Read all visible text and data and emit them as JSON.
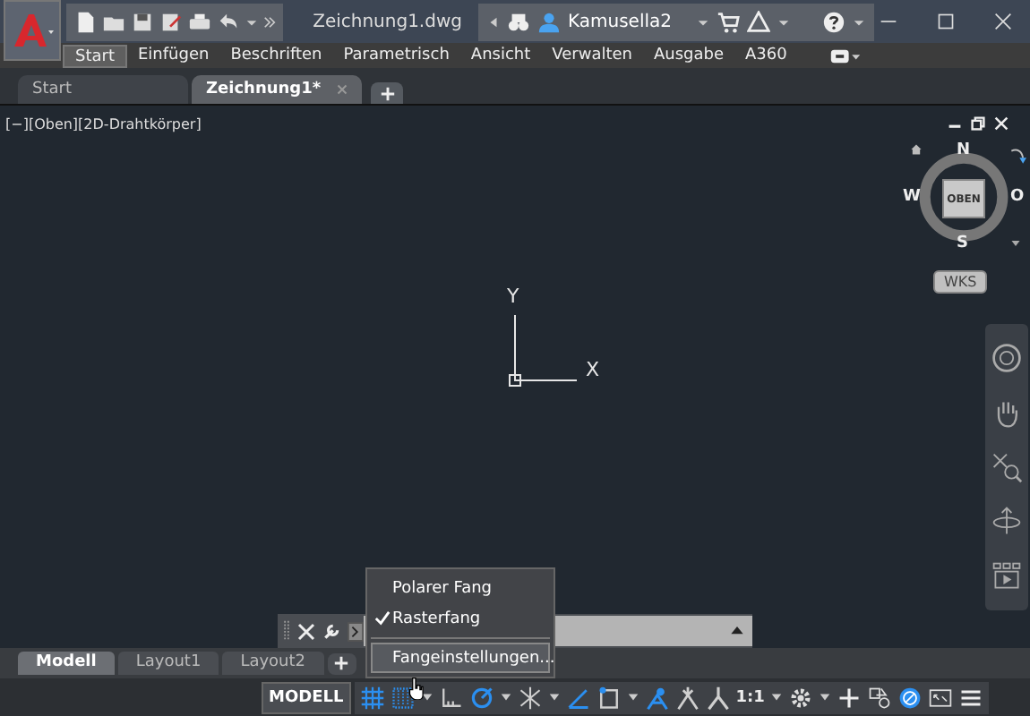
{
  "window": {
    "title": "Zeichnung1.dwg",
    "user": "Kamusella2"
  },
  "ribbon_tabs": [
    {
      "label": "Start",
      "selected": true
    },
    {
      "label": "Einfügen",
      "selected": false
    },
    {
      "label": "Beschriften",
      "selected": false
    },
    {
      "label": "Parametrisch",
      "selected": false
    },
    {
      "label": "Ansicht",
      "selected": false
    },
    {
      "label": "Verwalten",
      "selected": false
    },
    {
      "label": "Ausgabe",
      "selected": false
    },
    {
      "label": "A360",
      "selected": false
    }
  ],
  "file_tabs": [
    {
      "label": "Start",
      "selected": false
    },
    {
      "label": "Zeichnung1*",
      "selected": true
    }
  ],
  "viewport": {
    "label": "[−][Oben][2D-Drahtkörper]",
    "ucs": {
      "x": "X",
      "y": "Y"
    }
  },
  "viewcube": {
    "face": "OBEN",
    "north": "N",
    "south": "S",
    "west": "W",
    "east": "O",
    "ucs_menu": "WKS"
  },
  "popup_menu": [
    {
      "label": "Polarer Fang",
      "checked": false,
      "highlighted": false
    },
    {
      "label": "Rasterfang",
      "checked": true,
      "highlighted": false
    },
    {
      "label": "Fangeinstellungen...",
      "checked": false,
      "highlighted": true
    }
  ],
  "layout_tabs": [
    {
      "label": "Modell",
      "selected": true
    },
    {
      "label": "Layout1",
      "selected": false
    },
    {
      "label": "Layout2",
      "selected": false
    }
  ],
  "status_bar": {
    "model": "MODELL",
    "scale": "1:1",
    "tools": [
      {
        "kind": "grid",
        "on": true
      },
      {
        "kind": "snap",
        "on": true
      },
      {
        "kind": "ortho",
        "on": false
      },
      {
        "kind": "polar",
        "on": true
      },
      {
        "kind": "isodraft",
        "on": false
      },
      {
        "kind": "dynucs",
        "on": true
      },
      {
        "kind": "osnap",
        "on": false
      },
      {
        "kind": "annovis",
        "on": true
      },
      {
        "kind": "autoscale",
        "on": false
      },
      {
        "kind": "annoscale",
        "on": false
      }
    ]
  }
}
